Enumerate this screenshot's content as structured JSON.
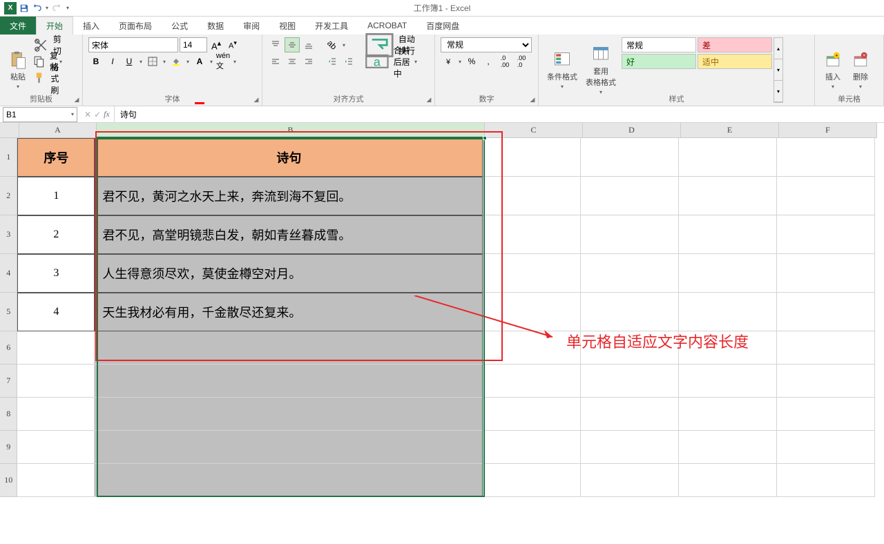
{
  "title": "工作簿1 - Excel",
  "tabs": {
    "file": "文件",
    "home": "开始",
    "insert": "插入",
    "layout": "页面布局",
    "formulas": "公式",
    "data": "数据",
    "review": "审阅",
    "view": "视图",
    "dev": "开发工具",
    "acrobat": "ACROBAT",
    "baidu": "百度网盘"
  },
  "ribbon": {
    "clipboard": {
      "paste": "粘贴",
      "cut": "剪切",
      "copy": "复制",
      "painter": "格式刷",
      "label": "剪贴板"
    },
    "font": {
      "name": "宋体",
      "size": "14",
      "label": "字体"
    },
    "align": {
      "wrap": "自动换行",
      "merge": "合并后居中",
      "label": "对齐方式"
    },
    "number": {
      "format": "常规",
      "label": "数字"
    },
    "styles": {
      "cond": "条件格式",
      "table": "套用\n表格格式",
      "normal": "常规",
      "bad": "差",
      "good": "好",
      "neutral": "适中",
      "label": "样式"
    },
    "cells": {
      "insert": "插入",
      "delete": "删除",
      "label": "单元格"
    }
  },
  "formula_bar": {
    "cell_ref": "B1",
    "value": "诗句"
  },
  "columns": [
    "A",
    "B",
    "C",
    "D",
    "E",
    "F"
  ],
  "col_widths": {
    "A": 112,
    "B": 562,
    "other": 142
  },
  "rows": [
    1,
    2,
    3,
    4,
    5,
    6,
    7,
    8,
    9,
    10
  ],
  "data_row_height": 56,
  "empty_row_height": 48,
  "table": {
    "header_num": "序号",
    "header_txt": "诗句",
    "rows": [
      {
        "num": "1",
        "txt": "君不见，黄河之水天上来，奔流到海不复回。"
      },
      {
        "num": "2",
        "txt": "君不见，高堂明镜悲白发，朝如青丝暮成雪。"
      },
      {
        "num": "3",
        "txt": "人生得意须尽欢，莫使金樽空对月。"
      },
      {
        "num": "4",
        "txt": "天生我材必有用，千金散尽还复来。"
      }
    ]
  },
  "annotation": "单元格自适应文字内容长度"
}
